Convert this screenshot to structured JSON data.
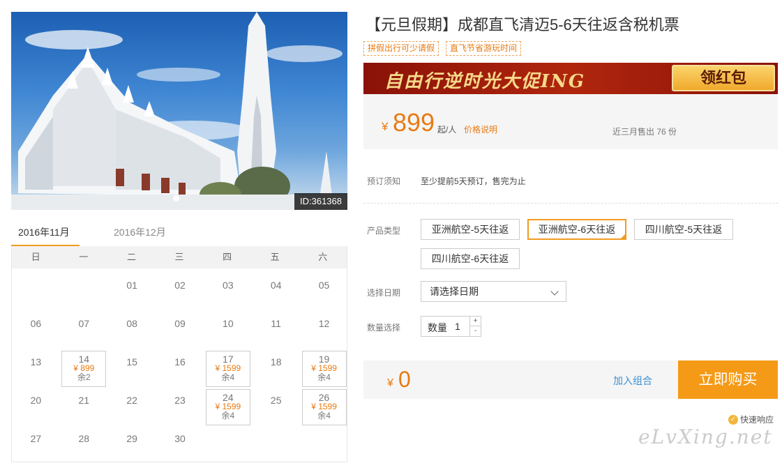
{
  "product": {
    "photo_id": "ID:361368",
    "title": "【元旦假期】成都直飞清迈5-6天往返含税机票",
    "tags": [
      "拼假出行可少请假",
      "直飞节省游玩时间"
    ]
  },
  "banner": {
    "text": "自由行逆时光大促ING",
    "button": "领红包"
  },
  "price": {
    "currency": "¥",
    "amount": "899",
    "unit": "起/人",
    "explain": "价格说明",
    "sold": "近三月售出 76 份"
  },
  "booking": {
    "notice_label": "预订须知",
    "notice_text": "至少提前5天预订，售完为止",
    "type_label": "产品类型",
    "types": [
      "亚洲航空-5天往返",
      "亚洲航空-6天往返",
      "四川航空-5天往返",
      "四川航空-6天往返"
    ],
    "selected_type": "亚洲航空-6天往返",
    "date_label": "选择日期",
    "date_placeholder": "请选择日期",
    "qty_label": "数量选择",
    "qty_field_label": "数量",
    "qty_value": "1",
    "qty_plus": "+",
    "qty_minus": "-"
  },
  "calendar": {
    "months": [
      "2016年11月",
      "2016年12月"
    ],
    "active_month": "2016年11月",
    "weekdays": [
      "日",
      "一",
      "二",
      "三",
      "四",
      "五",
      "六"
    ],
    "days": [
      {
        "day": "01",
        "col": 2,
        "row": 0
      },
      {
        "day": "02",
        "col": 3,
        "row": 0
      },
      {
        "day": "03",
        "col": 4,
        "row": 0
      },
      {
        "day": "04",
        "col": 5,
        "row": 0
      },
      {
        "day": "05",
        "col": 6,
        "row": 0
      },
      {
        "day": "06",
        "col": 0,
        "row": 1
      },
      {
        "day": "07",
        "col": 1,
        "row": 1
      },
      {
        "day": "08",
        "col": 2,
        "row": 1
      },
      {
        "day": "09",
        "col": 3,
        "row": 1
      },
      {
        "day": "10",
        "col": 4,
        "row": 1
      },
      {
        "day": "11",
        "col": 5,
        "row": 1
      },
      {
        "day": "12",
        "col": 6,
        "row": 1
      },
      {
        "day": "13",
        "col": 0,
        "row": 2
      },
      {
        "day": "14",
        "col": 1,
        "row": 2,
        "price": "¥ 899",
        "remain": "余2"
      },
      {
        "day": "15",
        "col": 2,
        "row": 2
      },
      {
        "day": "16",
        "col": 3,
        "row": 2
      },
      {
        "day": "17",
        "col": 4,
        "row": 2,
        "price": "¥ 1599",
        "remain": "余4"
      },
      {
        "day": "18",
        "col": 5,
        "row": 2
      },
      {
        "day": "19",
        "col": 6,
        "row": 2,
        "price": "¥ 1599",
        "remain": "余4"
      },
      {
        "day": "20",
        "col": 0,
        "row": 3
      },
      {
        "day": "21",
        "col": 1,
        "row": 3
      },
      {
        "day": "22",
        "col": 2,
        "row": 3
      },
      {
        "day": "23",
        "col": 3,
        "row": 3
      },
      {
        "day": "24",
        "col": 4,
        "row": 3,
        "price": "¥ 1599",
        "remain": "余4"
      },
      {
        "day": "25",
        "col": 5,
        "row": 3
      },
      {
        "day": "26",
        "col": 6,
        "row": 3,
        "price": "¥ 1599",
        "remain": "余4"
      },
      {
        "day": "27",
        "col": 0,
        "row": 4
      },
      {
        "day": "28",
        "col": 1,
        "row": 4
      },
      {
        "day": "29",
        "col": 2,
        "row": 4
      },
      {
        "day": "30",
        "col": 3,
        "row": 4
      }
    ]
  },
  "checkout": {
    "currency": "¥",
    "total": "0",
    "add_combo": "加入组合",
    "buy_now": "立即购买",
    "fast_response": "快速响应"
  },
  "watermark": "eLvXing.net",
  "colors": {
    "accent": "#f29b1f",
    "price": "#e87a12",
    "link": "#3b8fd4",
    "buy_button": "#f59a16"
  }
}
